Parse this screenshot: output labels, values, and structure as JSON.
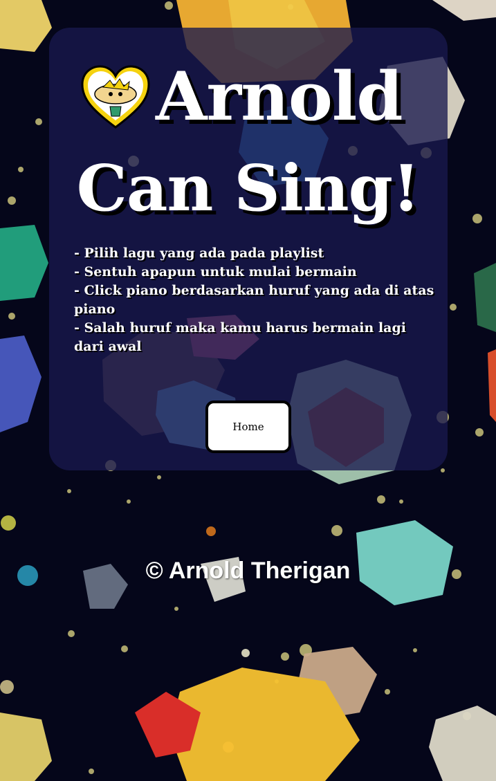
{
  "header": {
    "title_line1": "Arnold",
    "title_line2": "Can Sing!",
    "logo_icon": "arnold-heart-icon"
  },
  "instructions": [
    "- Pilih lagu yang ada pada playlist",
    "- Sentuh apapun untuk mulai bermain",
    "- Click piano berdasarkan huruf yang ada di atas piano",
    "- Salah huruf maka kamu harus bermain lagi dari awal"
  ],
  "buttons": {
    "home_label": "Home"
  },
  "footer": {
    "copyright": "© Arnold Therigan"
  },
  "colors": {
    "card_background": "#18184e",
    "page_background": "#05061a",
    "heart_yellow": "#f5d20f",
    "text_white": "#ffffff"
  }
}
